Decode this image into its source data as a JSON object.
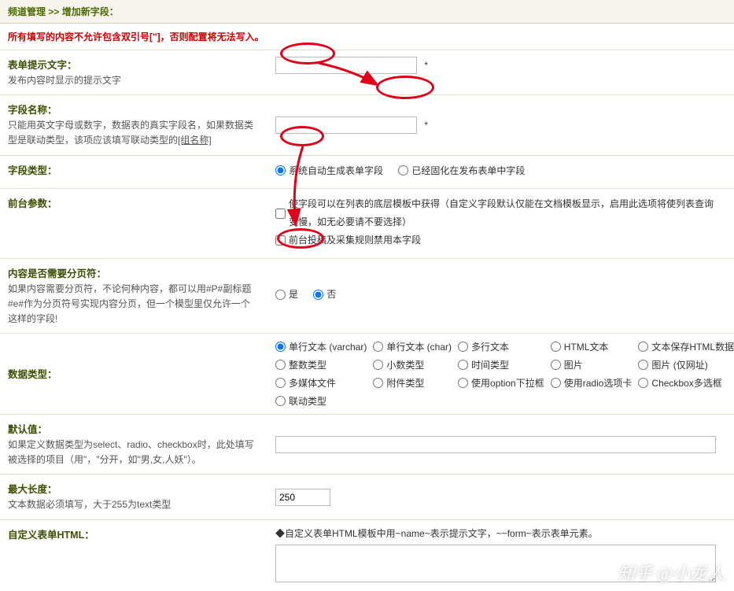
{
  "breadcrumb": {
    "a": "频道管理",
    "sep": " >> ",
    "b": "增加新字段："
  },
  "warn": "所有填写的内容不允许包含双引号[\"]，否则配置将无法写入。",
  "rows": {
    "prompt": {
      "title": "表单提示文字：",
      "desc": "发布内容时显示的提示文字",
      "star": "*"
    },
    "name": {
      "title": "字段名称：",
      "desc": "只能用英文字母或数字，数据表的真实字段名，如果数据类型是联动类型，该项应该填写联动类型的",
      "desc_ul": "[组名称]",
      "star": "*"
    },
    "ftype": {
      "title": "字段类型：",
      "r1": "系统自动生成表单字段",
      "r2": "已经固化在发布表单中字段"
    },
    "front": {
      "title": "前台参数：",
      "c1": "使字段可以在列表的底层模板中获得（自定义字段默认仅能在文档模板显示，启用此选项将使列表查询变慢，如无必要请不要选择）",
      "c2": "前台投稿及采集规则禁用本字段"
    },
    "page": {
      "title": "内容是否需要分页符：",
      "desc": "如果内容需要分页符，不论何种内容，都可以用#P#副标题#e#作为分页符号实现内容分页，但一个模型里仅允许一个这样的字段!",
      "r1": "是",
      "r2": "否"
    },
    "dtype": {
      "title": "数据类型：",
      "opts": [
        "单行文本 (varchar)",
        "单行文本 (char)",
        "多行文本",
        "HTML文本",
        "文本保存HTML数据",
        "整数类型",
        "小数类型",
        "时间类型",
        "图片",
        "图片 (仅网址)",
        "多媒体文件",
        "附件类型",
        "使用option下拉框",
        "使用radio选项卡",
        "Checkbox多选框",
        "联动类型"
      ]
    },
    "defv": {
      "title": "默认值：",
      "desc": "如果定义数据类型为select、radio、checkbox时，此处填写被选择的项目（用\"，\"分开，如\"男,女,人妖\"）。"
    },
    "maxlen": {
      "title": "最大长度：",
      "desc": "文本数据必须填写，大于255为text类型",
      "val": "250"
    },
    "custom": {
      "title": "自定义表单HTML：",
      "note": "◆自定义表单HTML模板中用~name~表示提示文字，~~form~表示表单元素。"
    }
  },
  "watermark": "知乎 @小龙人"
}
